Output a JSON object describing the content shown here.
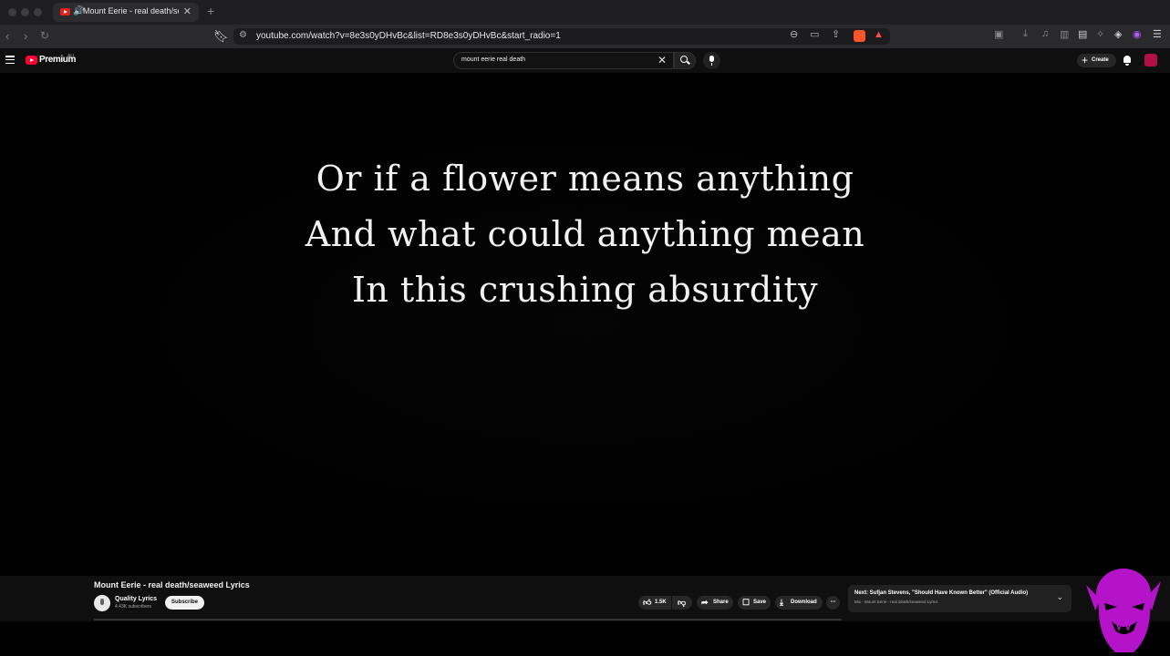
{
  "browser": {
    "tab": {
      "title": "Mount Eerie - real death/seaweed Lyrics - YouTube"
    },
    "address_bar": {
      "url": "youtube.com/watch?v=8e3s0yDHvBc&list=RD8e3s0yDHvBc&start_radio=1"
    },
    "extensions": [
      "brave-shield-icon",
      "rewards-icon"
    ],
    "colors": {
      "chrome": "#1e1e20",
      "toolbar": "#2a2a2d"
    }
  },
  "youtube": {
    "logo_text": "Premium",
    "logo_sup": "AU",
    "search": {
      "query": "mount eerie real death",
      "placeholder": "Search"
    },
    "create_label": "Create",
    "colors": {
      "brand": "#ff0033",
      "background": "#0f0f0f"
    }
  },
  "video": {
    "lyrics": [
      "Or if a flower means anything",
      "And what could anything mean",
      "In this crushing absurdity"
    ]
  },
  "info": {
    "title": "Mount Eerie - real death/seaweed Lyrics",
    "channel": {
      "name": "Quality Lyrics",
      "subscribers": "4.43K subscribers"
    },
    "subscribe_label": "Subscribe",
    "likes": "1.5K",
    "share_label": "Share",
    "save_label": "Save",
    "download_label": "Download",
    "next": {
      "label": "Next: Sufjan Stevens, \"Should Have Known Better\" (Official Audio)",
      "sub": "Mix - Mount Eerie - real death/seaweed Lyrics"
    }
  }
}
